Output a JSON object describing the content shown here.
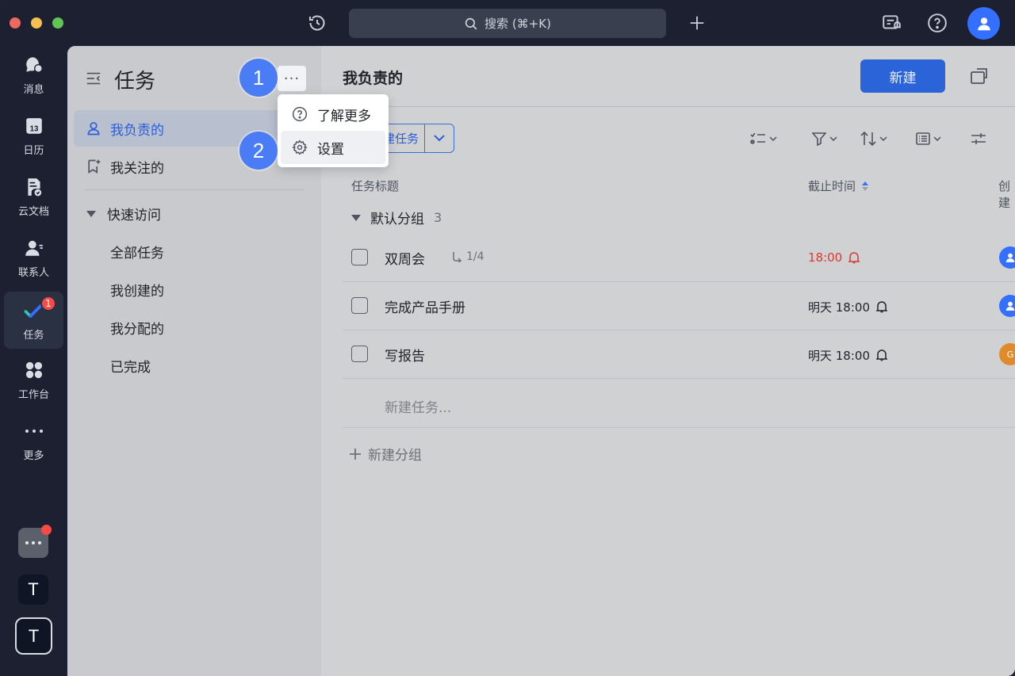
{
  "topbar": {
    "search_placeholder": "搜索 (⌘+K)"
  },
  "rail": {
    "items": [
      {
        "label": "消息"
      },
      {
        "label": "日历",
        "icon_text": "13"
      },
      {
        "label": "云文档"
      },
      {
        "label": "联系人"
      },
      {
        "label": "任务",
        "badge": "1"
      },
      {
        "label": "工作台"
      },
      {
        "label": "更多"
      }
    ],
    "bottom": [
      {
        "text": "T"
      },
      {
        "text": "T"
      }
    ]
  },
  "sidebar": {
    "title": "任务",
    "more": "···",
    "items": [
      {
        "label": "我负责的"
      },
      {
        "label": "我关注的"
      }
    ],
    "section": "快速访问",
    "sub_items": [
      "全部任务",
      "我创建的",
      "我分配的",
      "已完成"
    ]
  },
  "menu": {
    "items": [
      {
        "label": "了解更多"
      },
      {
        "label": "设置"
      }
    ]
  },
  "steps": [
    "1",
    "2"
  ],
  "main": {
    "title": "我负责的",
    "new_button": "新建",
    "split_button_label": "建任务",
    "columns": {
      "title": "任务标题",
      "due": "截止时间",
      "creator": "创建"
    },
    "group": {
      "name": "默认分组",
      "count": "3"
    },
    "tasks": [
      {
        "name": "双周会",
        "subtask": "1/4",
        "due": "18:00",
        "avatar": ""
      },
      {
        "name": "完成产品手册",
        "due": "明天 18:00",
        "avatar": ""
      },
      {
        "name": "写报告",
        "due": "明天 18:00",
        "avatar": "G"
      }
    ],
    "new_task_placeholder": "新建任务...",
    "new_group": "新建分组"
  },
  "colors": {
    "accent": "#2b63d9",
    "overdue": "#d83931",
    "step": "#4a7cf6"
  }
}
